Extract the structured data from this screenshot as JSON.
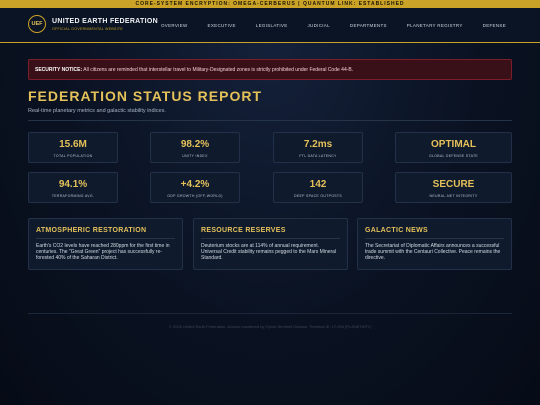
{
  "top_banner": "CORE-SYSTEM ENCRYPTION: OMEGA-CERBERUS | QUANTUM LINK: ESTABLISHED",
  "brand": {
    "logo": "UEF",
    "title": "UNITED EARTH FEDERATION",
    "subtitle": "OFFICIAL GOVERNMENTAL WEBSITE"
  },
  "nav": [
    "OVERVIEW",
    "EXECUTIVE",
    "LEGISLATIVE",
    "JUDICIAL",
    "DEPARTMENTS",
    "PLANETARY REGISTRY",
    "DEFENSE"
  ],
  "notice": {
    "label": "SECURITY NOTICE:",
    "text": "All citizens are reminded that interstellar travel to Military-Designated zones is strictly prohibited under Federal Code 44-B."
  },
  "page": {
    "title": "FEDERATION STATUS REPORT",
    "subtitle": "Real-time planetary metrics and galactic stability indices."
  },
  "metrics": [
    {
      "value": "15.6M",
      "label": "TOTAL POPULATION"
    },
    {
      "value": "98.2%",
      "label": "UNITY INDEX"
    },
    {
      "value": "7.2ms",
      "label": "FTL DATA LATENCY"
    },
    {
      "value": "OPTIMAL",
      "label": "GLOBAL DEFENSE STATE"
    },
    {
      "value": "94.1%",
      "label": "TERRAFORMING AVG."
    },
    {
      "value": "+4.2%",
      "label": "GDP GROWTH (OFF-WORLD)"
    },
    {
      "value": "142",
      "label": "DEEP SPACE OUTPOSTS"
    },
    {
      "value": "SECURE",
      "label": "NEURAL-NET INTEGRITY"
    }
  ],
  "panels": [
    {
      "title": "ATMOSPHERIC RESTORATION",
      "body": "Earth's CO2 levels have reached 280ppm for the first time in centuries. The \"Great Green\" project has successfully re-forested 40% of the Saharan District."
    },
    {
      "title": "RESOURCE RESERVES",
      "body": "Deuterium stocks are at 114% of annual requirement. Universal Credit stability remains pegged to the Mars Mineral Standard."
    },
    {
      "title": "GALACTIC NEWS",
      "body": "The Secretariat of Diplomatic Affairs announces a successful trade summit with the Centauri Collective. Peace remains the directive."
    }
  ],
  "footer": "© 2026 United Earth Federation. Access monitored by Cyber-Sentinel Division. Terminal ID: LT-994 (PLANETARY)"
}
